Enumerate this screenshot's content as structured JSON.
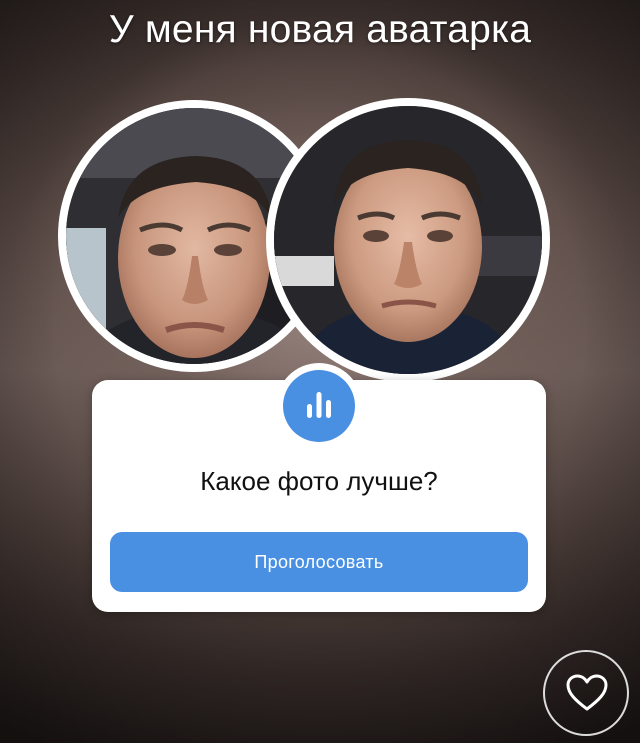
{
  "headline": "У меня новая аватарка",
  "avatars": [
    {
      "icon": "profile-photo-old"
    },
    {
      "icon": "profile-photo-new"
    }
  ],
  "poll": {
    "icon": "poll-chart-icon",
    "question": "Какое фото лучше?",
    "vote_label": "Проголосовать",
    "accent_color": "#4a90e2"
  },
  "like": {
    "icon": "heart-icon"
  }
}
